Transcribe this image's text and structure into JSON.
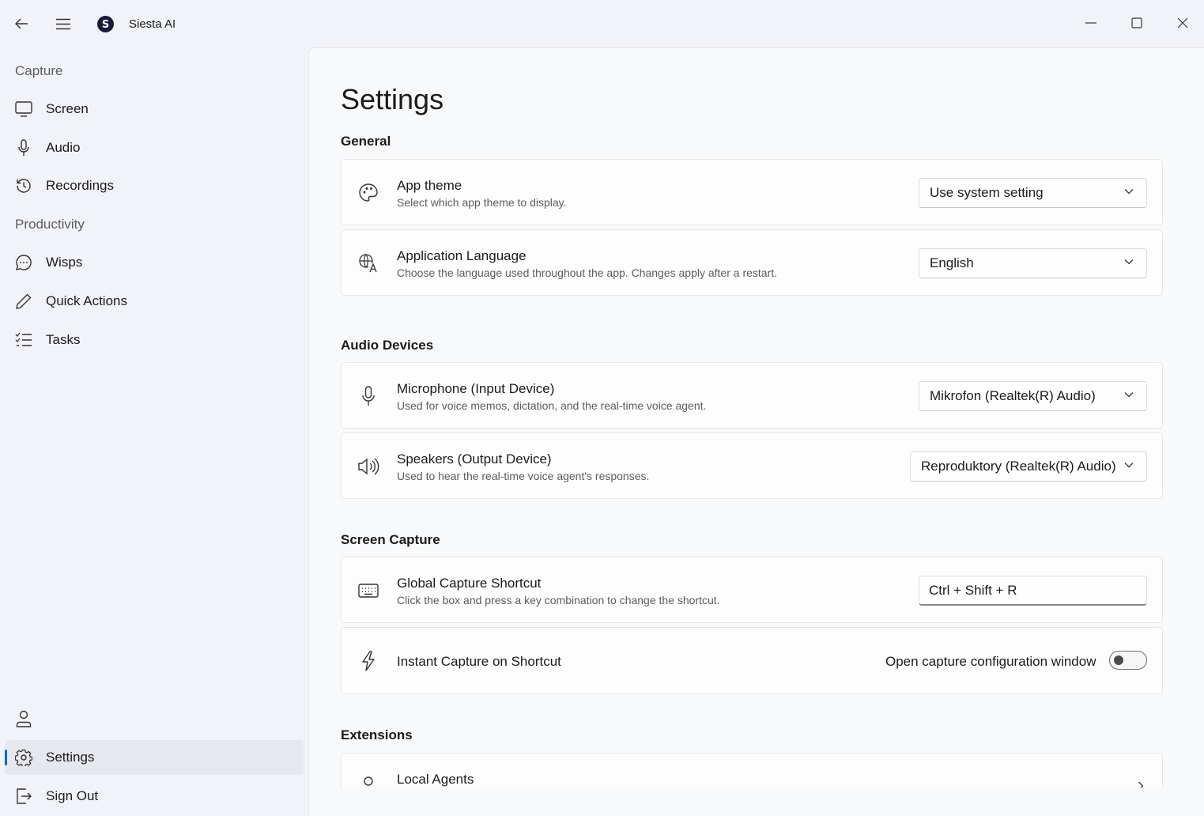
{
  "app": {
    "title": "Siesta AI",
    "logo_letter": "S"
  },
  "sidebar": {
    "sections": [
      {
        "header": "Capture",
        "items": [
          {
            "label": "Screen",
            "icon": "monitor-icon"
          },
          {
            "label": "Audio",
            "icon": "microphone-icon"
          },
          {
            "label": "Recordings",
            "icon": "history-icon"
          }
        ]
      },
      {
        "header": "Productivity",
        "items": [
          {
            "label": "Wisps",
            "icon": "chat-bubble-icon"
          },
          {
            "label": "Quick Actions",
            "icon": "pencil-icon"
          },
          {
            "label": "Tasks",
            "icon": "task-list-icon"
          }
        ]
      }
    ],
    "footer": [
      {
        "label": "",
        "icon": "person-icon"
      },
      {
        "label": "Settings",
        "icon": "gear-icon",
        "active": true
      },
      {
        "label": "Sign Out",
        "icon": "sign-out-icon"
      }
    ]
  },
  "page": {
    "title": "Settings",
    "sections": {
      "general": {
        "title": "General",
        "app_theme": {
          "title": "App theme",
          "description": "Select which app theme to display.",
          "value": "Use system setting",
          "icon": "palette-icon"
        },
        "language": {
          "title": "Application Language",
          "description": "Choose the language used throughout the app. Changes apply after a restart.",
          "value": "English",
          "icon": "language-icon"
        }
      },
      "audio": {
        "title": "Audio Devices",
        "microphone": {
          "title": "Microphone (Input Device)",
          "description": "Used for voice memos, dictation, and the real-time voice agent.",
          "value": "Mikrofon (Realtek(R) Audio)",
          "icon": "microphone-icon"
        },
        "speakers": {
          "title": "Speakers (Output Device)",
          "description": "Used to hear the real-time voice agent's responses.",
          "value": "Reproduktory (Realtek(R) Audio)",
          "icon": "speaker-icon"
        }
      },
      "screen": {
        "title": "Screen Capture",
        "shortcut": {
          "title": "Global Capture Shortcut",
          "description": "Click the box and press a key combination to change the shortcut.",
          "value": "Ctrl + Shift + R",
          "icon": "keyboard-icon"
        },
        "instant": {
          "title": "Instant Capture on Shortcut",
          "toggle_label": "Open capture configuration window",
          "toggle_on": false,
          "icon": "lightning-icon"
        }
      },
      "extensions": {
        "title": "Extensions",
        "local_agents": {
          "title": "Local Agents",
          "icon": "person-icon"
        }
      }
    }
  },
  "colors": {
    "accent": "#0f6cbd",
    "sidebar_bg": "#f1f3f8",
    "content_bg": "#f8f9fb",
    "logo_bg": "#1a1a3a"
  }
}
